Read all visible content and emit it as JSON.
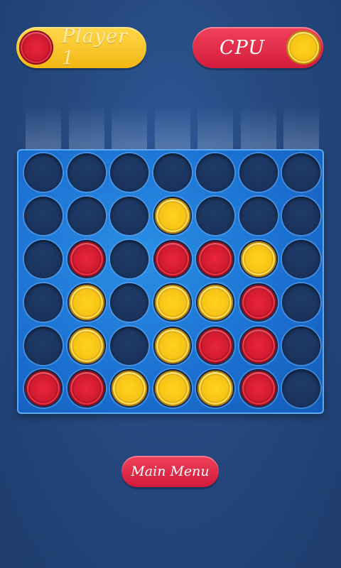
{
  "players": {
    "player1": {
      "label": "Player 1",
      "disc_color": "red"
    },
    "cpu": {
      "label": "CPU",
      "disc_color": "yellow"
    }
  },
  "board": {
    "columns": 7,
    "rows": 6,
    "grid": [
      [
        "",
        "",
        "",
        "",
        "",
        "",
        ""
      ],
      [
        "",
        "",
        "",
        "Y",
        "",
        "",
        ""
      ],
      [
        "",
        "R",
        "",
        "R",
        "R",
        "Y",
        ""
      ],
      [
        "",
        "Y",
        "",
        "Y",
        "Y",
        "R",
        ""
      ],
      [
        "",
        "Y",
        "",
        "Y",
        "R",
        "R",
        ""
      ],
      [
        "R",
        "R",
        "Y",
        "Y",
        "Y",
        "R",
        ""
      ]
    ]
  },
  "main_menu_label": "Main Menu",
  "colors": {
    "red": "#d21b30",
    "yellow": "#f6c416",
    "board": "#1a6fd0",
    "background": "#26497f"
  }
}
